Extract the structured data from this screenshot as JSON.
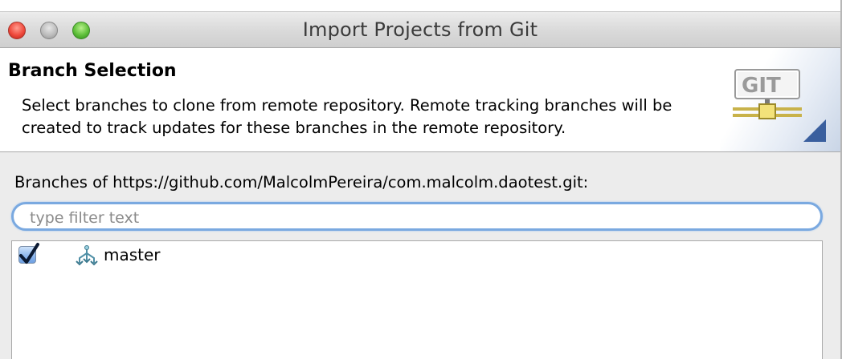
{
  "window": {
    "title": "Import Projects from Git"
  },
  "banner": {
    "heading": "Branch Selection",
    "description": "Select branches to clone from remote repository. Remote tracking branches will be created to track updates for these branches in the remote repository.",
    "logo_text": "GIT"
  },
  "branches": {
    "label": "Branches of https://github.com/MalcolmPereira/com.malcolm.daotest.git:",
    "filter": {
      "value": "",
      "placeholder": "type filter text"
    },
    "items": [
      {
        "label": "master",
        "checked": true,
        "icon": "git-branch-icon"
      }
    ]
  },
  "colors": {
    "close": "#f04a3d",
    "minimize": "#b9b9b9",
    "zoom": "#5fc03a",
    "focus_ring": "#7aa9e0",
    "corner_accent": "#3a5f9e"
  }
}
